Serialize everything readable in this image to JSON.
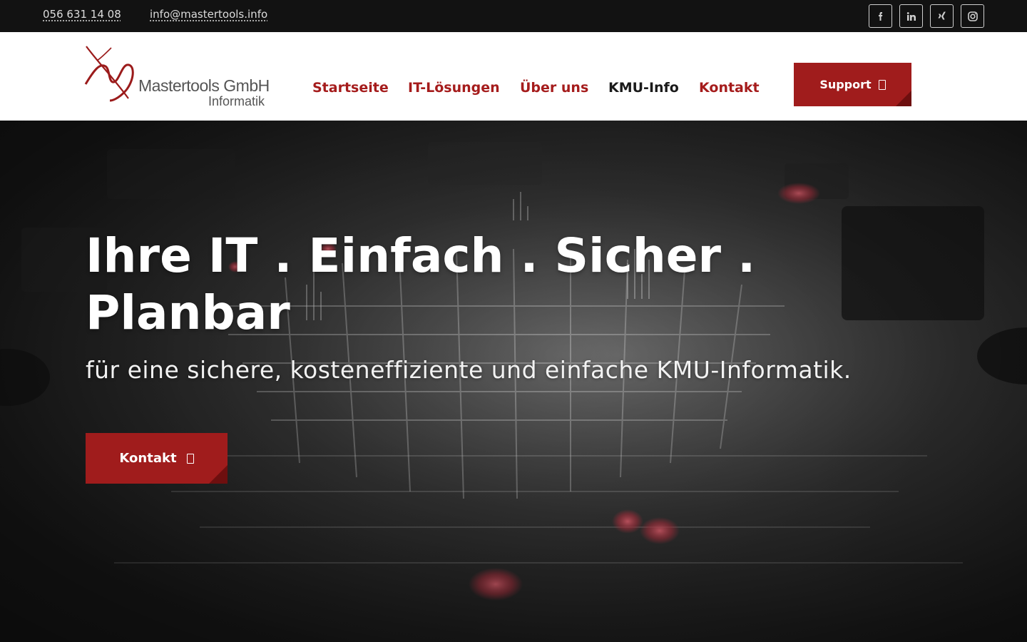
{
  "topbar": {
    "phone": "056 631 14 08",
    "email": "info@mastertools.info",
    "social_icons": [
      "facebook-icon",
      "linkedin-icon",
      "xing-icon",
      "instagram-icon"
    ]
  },
  "header": {
    "logo": {
      "company": "Mastertools GmbH",
      "subtitle": "Informatik"
    },
    "nav": [
      {
        "label": "Startseite",
        "active": false
      },
      {
        "label": "IT-Lösungen",
        "active": false
      },
      {
        "label": "Über uns",
        "active": false
      },
      {
        "label": "KMU-Info",
        "active": true
      },
      {
        "label": "Kontakt",
        "active": false
      }
    ],
    "support_label": "Support"
  },
  "hero": {
    "title": "Ihre IT . Einfach . Sicher . Planbar",
    "subtitle": "für eine sichere, kosteneffiziente und einfache KMU-Informatik.",
    "button_label": "Kontakt"
  },
  "colors": {
    "brand_red": "#a01c1c",
    "topbar_bg": "#121212",
    "nav_active": "#1a1a1a"
  }
}
